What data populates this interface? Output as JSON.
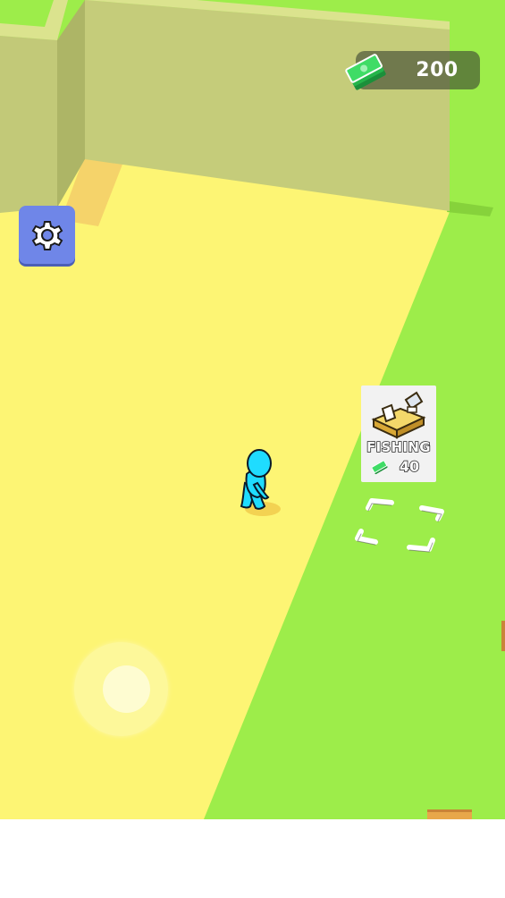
{
  "hud": {
    "money_amount": "200",
    "money_icon": "cash-stack-icon",
    "settings_icon": "gear-icon"
  },
  "station": {
    "name": "FISHING",
    "price": "40",
    "icon": "fishing-desk-icon",
    "price_icon": "cash-icon"
  },
  "colors": {
    "grass": "#9ded4a",
    "floor": "#fdf574",
    "wall": "#c5cc7a",
    "player": "#1fdcff",
    "settings_button": "#6f86e8",
    "money_pill": "#3c4632"
  }
}
